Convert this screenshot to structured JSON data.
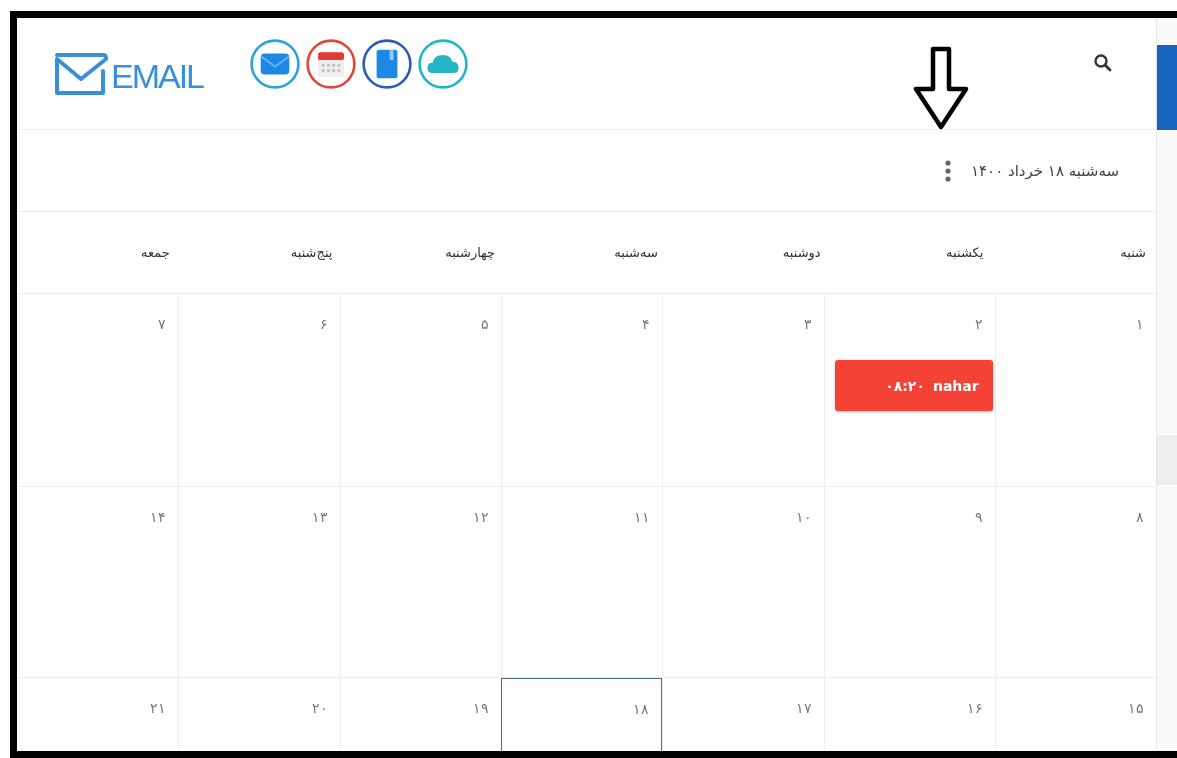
{
  "header": {
    "logo_text": "EMAIL",
    "apps": [
      {
        "kind": "mail",
        "color": "#2aa3d8"
      },
      {
        "kind": "calendar",
        "color": "#e0473c"
      },
      {
        "kind": "book",
        "color": "#2b5db4"
      },
      {
        "kind": "cloud",
        "color": "#22b3c4"
      }
    ]
  },
  "date_bar": {
    "date": "سه‌شنبه ۱۸ خرداد ۱۴۰۰"
  },
  "weekdays": [
    "شنبه",
    "یکشنبه",
    "دوشنبه",
    "سه‌شنبه",
    "چهارشنبه",
    "پنج‌شنبه",
    "جمعه"
  ],
  "weeks": [
    [
      {
        "day": "۱",
        "selected": false
      },
      {
        "day": "۲",
        "selected": false,
        "events": [
          {
            "title": "nahar",
            "time": "۰۸:۲۰",
            "color": "#f44336"
          }
        ]
      },
      {
        "day": "۳",
        "selected": false
      },
      {
        "day": "۴",
        "selected": false
      },
      {
        "day": "۵",
        "selected": false
      },
      {
        "day": "۶",
        "selected": false
      },
      {
        "day": "۷",
        "selected": false
      }
    ],
    [
      {
        "day": "۸",
        "selected": false
      },
      {
        "day": "۹",
        "selected": false
      },
      {
        "day": "۱۰",
        "selected": false
      },
      {
        "day": "۱۱",
        "selected": false
      },
      {
        "day": "۱۲",
        "selected": false
      },
      {
        "day": "۱۳",
        "selected": false
      },
      {
        "day": "۱۴",
        "selected": false
      }
    ],
    [
      {
        "day": "۱۵",
        "selected": false
      },
      {
        "day": "۱۶",
        "selected": false
      },
      {
        "day": "۱۷",
        "selected": false
      },
      {
        "day": "۱۸",
        "selected": true
      },
      {
        "day": "۱۹",
        "selected": false
      },
      {
        "day": "۲۰",
        "selected": false
      },
      {
        "day": "۲۱",
        "selected": false
      }
    ]
  ]
}
